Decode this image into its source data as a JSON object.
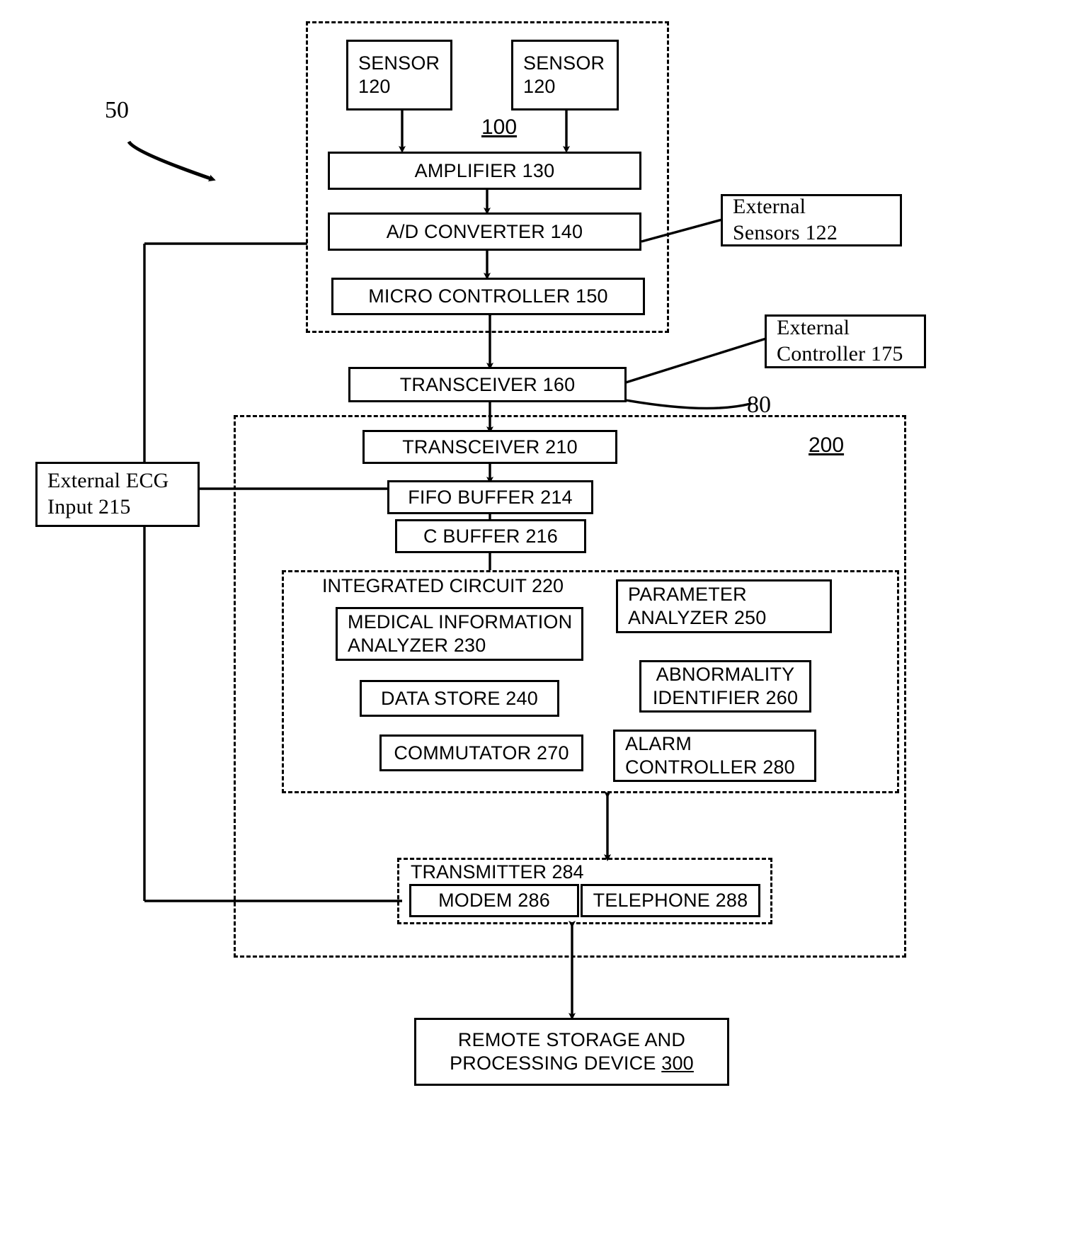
{
  "figure": {
    "type": "patent-block-diagram",
    "reference_numerals": {
      "system": "50",
      "monitor_unit": "100",
      "link": "80",
      "base_unit": "200"
    }
  },
  "boxes": {
    "sensor_left": "SENSOR\n120",
    "sensor_left_line1": "SENSOR",
    "sensor_left_line2": "120",
    "sensor_right_line1": "SENSOR",
    "sensor_right_line2": "120",
    "amplifier": "AMPLIFIER 130",
    "ad_converter": "A/D CONVERTER 140",
    "micro_controller": "MICRO CONTROLLER 150",
    "transceiver_160": "TRANSCEIVER 160",
    "transceiver_210": "TRANSCEIVER 210",
    "fifo_buffer": "FIFO BUFFER 214",
    "c_buffer": "C BUFFER 216",
    "external_sensors_l1": "External",
    "external_sensors_l2": "Sensors  122",
    "external_controller_l1": "External",
    "external_controller_l2": "Controller  175",
    "external_ecg_l1": "External ECG",
    "external_ecg_l2": "Input  215",
    "medical_info_analyzer_l1": "MEDICAL INFORMATION",
    "medical_info_analyzer_l2": "ANALYZER 230",
    "data_store": "DATA STORE 240",
    "commutator": "COMMUTATOR 270",
    "parameter_analyzer_l1": "PARAMETER",
    "parameter_analyzer_l2": "ANALYZER 250",
    "abnormality_identifier_l1": "ABNORMALITY",
    "abnormality_identifier_l2": "IDENTIFIER 260",
    "alarm_controller_l1": "ALARM",
    "alarm_controller_l2": "CONTROLLER 280",
    "modem": "MODEM 286",
    "telephone": "TELEPHONE 288",
    "remote_storage_l1": "REMOTE STORAGE AND",
    "remote_storage_l2a": "PROCESSING  DEVICE ",
    "remote_storage_l2b": "300"
  },
  "group_labels": {
    "integrated_circuit": "INTEGRATED CIRCUIT 220",
    "transmitter": "TRANSMITTER 284"
  },
  "ref_labels": {
    "n50": "50",
    "n100": "100",
    "n80": "80",
    "n200": "200"
  },
  "colors": {
    "stroke": "#000000",
    "background": "#ffffff"
  }
}
